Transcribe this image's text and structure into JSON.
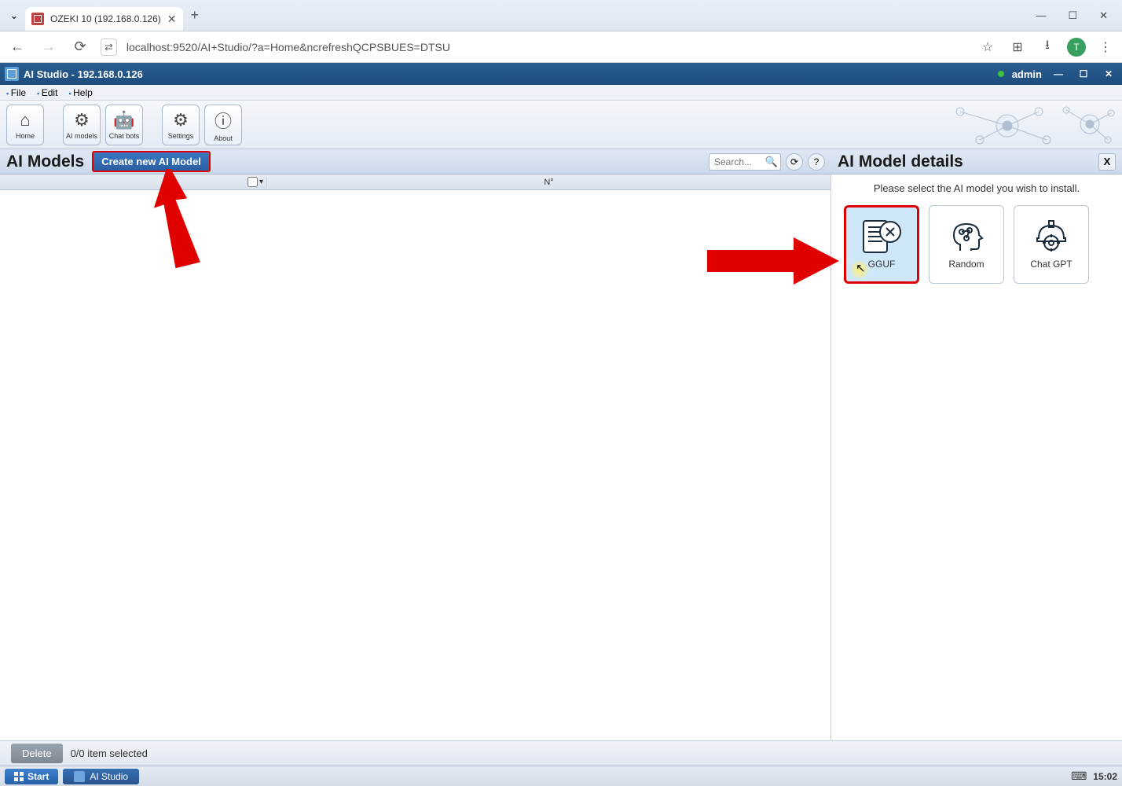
{
  "browser": {
    "tab_title": "OZEKI 10 (192.168.0.126)",
    "url": "localhost:9520/AI+Studio/?a=Home&ncrefreshQCPSBUES=DTSU",
    "avatar_initial": "T"
  },
  "app": {
    "title": "AI Studio - 192.168.0.126",
    "user": "admin"
  },
  "menu": {
    "file": "File",
    "edit": "Edit",
    "help": "Help"
  },
  "toolbar": {
    "home": "Home",
    "ai_models": "AI models",
    "chat_bots": "Chat bots",
    "settings": "Settings",
    "about": "About"
  },
  "page": {
    "title": "AI Models",
    "create_btn": "Create new AI Model",
    "search_placeholder": "Search..."
  },
  "table": {
    "col_n": "N°"
  },
  "details": {
    "title": "AI Model details",
    "prompt": "Please select the AI model you wish to install.",
    "models": {
      "gguf": "GGUF",
      "random": "Random",
      "chatgpt": "Chat GPT"
    }
  },
  "footer": {
    "delete": "Delete",
    "status": "0/0 item selected"
  },
  "taskbar": {
    "start": "Start",
    "app": "AI Studio",
    "time": "15:02"
  }
}
